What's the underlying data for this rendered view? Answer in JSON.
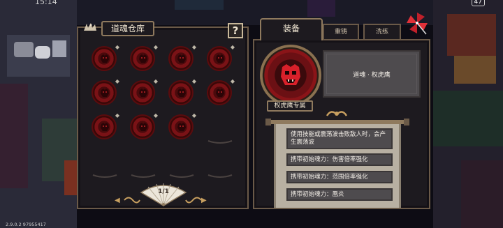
{
  "status": {
    "time": "15:14",
    "battery": "47"
  },
  "version": "2.9.0.2 97955417",
  "storage": {
    "title": "道魂仓库",
    "help_label": "?",
    "page": "1/1",
    "prev_label": "◀",
    "next_label": "▶",
    "slots": [
      {
        "filled": true,
        "badge": "◆"
      },
      {
        "filled": true,
        "badge": "◆"
      },
      {
        "filled": true,
        "badge": "◆"
      },
      {
        "filled": true,
        "badge": "◆"
      },
      {
        "filled": true,
        "badge": "◆"
      },
      {
        "filled": true,
        "badge": "◆"
      },
      {
        "filled": true,
        "badge": "◆"
      },
      {
        "filled": true,
        "badge": "◆"
      },
      {
        "filled": true,
        "badge": "◆"
      },
      {
        "filled": true,
        "badge": "◆"
      },
      {
        "filled": true,
        "badge": "◆"
      },
      {
        "filled": false
      },
      {
        "filled": false
      },
      {
        "filled": false
      },
      {
        "filled": false
      },
      {
        "filled": false
      }
    ]
  },
  "tabs": {
    "equip": "装备",
    "recast": "重铸",
    "refine": "洗练"
  },
  "equipped": {
    "name": "道魂 · 权虎鹰",
    "exclusive_tag": "权虎鹰专属",
    "effects": [
      "使用技能或震荡波击败敌人时，会产生震荡波",
      "携带初始魂力：伤害倍率强化",
      "携带初始魂力：范围倍率强化",
      "携带初始魂力：凰炎"
    ]
  },
  "colors": {
    "soul_red": "#7a1216",
    "panel_bg": "#1d1a1f",
    "frame": "#6b5a48",
    "scroll": "#b8b0a2"
  }
}
